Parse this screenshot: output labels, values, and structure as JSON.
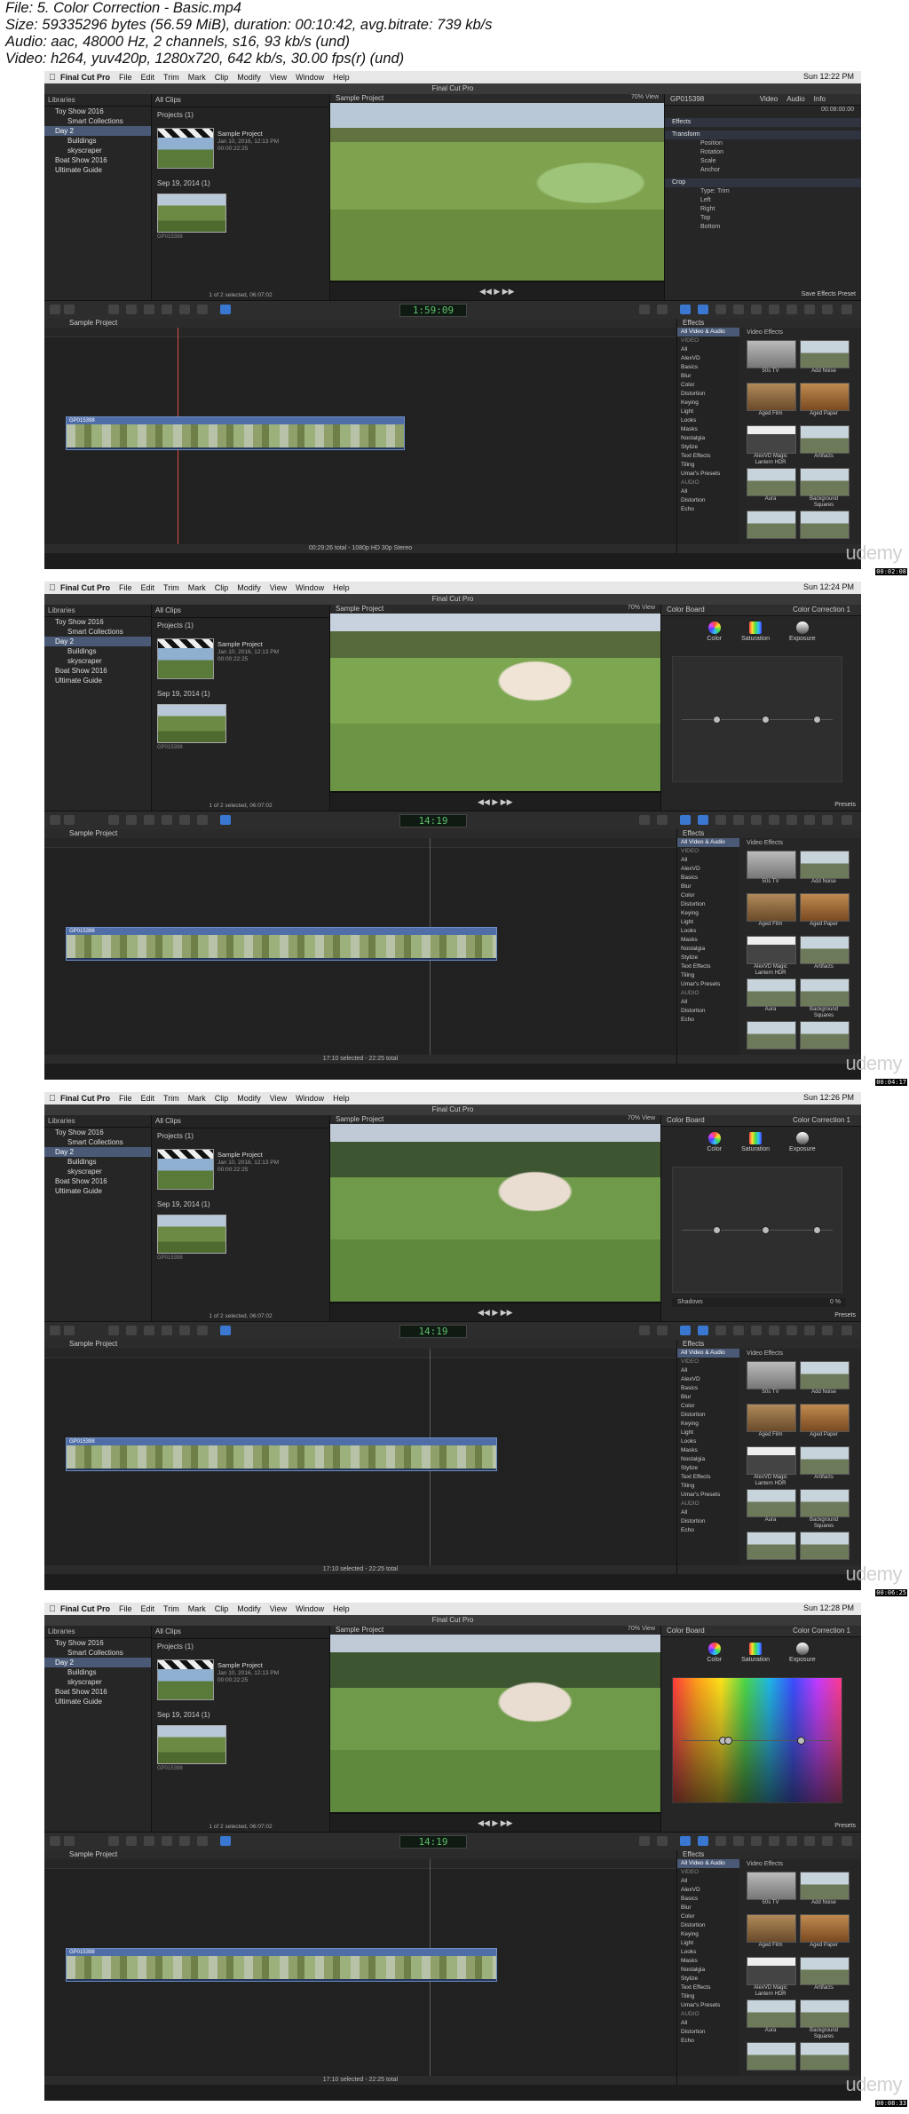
{
  "header": {
    "line1": "File: 5. Color Correction - Basic.mp4",
    "line2": "Size: 59335296 bytes (56.59 MiB), duration: 00:10:42, avg.bitrate: 739 kb/s",
    "line3": "Audio: aac, 48000 Hz, 2 channels, s16, 93 kb/s (und)",
    "line4": "Video: h264, yuv420p, 1280x720, 642 kb/s, 30.00 fps(r) (und)"
  },
  "menu": [
    "Final Cut Pro",
    "File",
    "Edit",
    "Trim",
    "Mark",
    "Clip",
    "Modify",
    "View",
    "Window",
    "Help"
  ],
  "app_title": "Final Cut Pro",
  "library": {
    "header": "Libraries",
    "items": [
      "Toy Show 2016",
      "Smart Collections",
      "Day 2",
      "Buildings",
      "skyscraper",
      "Boat Show 2016",
      "Ultimate Guide"
    ]
  },
  "browser": {
    "filter": "All Clips",
    "projects_label": "Projects",
    "projects_count": "(1)",
    "project_name": "Sample Project",
    "project_date": "Jan 10, 2016, 12:13 PM",
    "project_dur": "00:00:22:25",
    "date_group": "Sep 19, 2014",
    "date_count": "(1)",
    "clip_id": "GP015398",
    "status": "1 of 2 selected, 06:07:02"
  },
  "viewer": {
    "title": "Sample Project",
    "zoom": "70%",
    "view": "View"
  },
  "effects": {
    "title": "Effects",
    "all_label": "All Video & Audio",
    "video_header": "Video Effects",
    "categories": [
      "VIDEO",
      "All",
      "AlexVD",
      "Basics",
      "Blur",
      "Color",
      "Distortion",
      "Keying",
      "Light",
      "Looks",
      "Masks",
      "Nostalgia",
      "Stylize",
      "Text Effects",
      "Tiling",
      "Umar's Presets",
      "AUDIO",
      "All",
      "Distortion",
      "Echo"
    ],
    "tiles": [
      "50s TV",
      "Add Noise",
      "Aged Film",
      "Aged Paper",
      "AlexVD Magic Lantern HDR",
      "Artifacts",
      "Aura",
      "Background Squares"
    ]
  },
  "frames": [
    {
      "time": "Sun 12:22 PM",
      "timecode": "1:59:09",
      "inspector_mode": "effects",
      "clip_name": "GP015398",
      "clip_tc": "00:08:00:00",
      "insp_tabs": [
        "Video",
        "Audio",
        "Info"
      ],
      "insp_rows": [
        "Effects",
        "Transform",
        "Position",
        "Rotation",
        "Scale",
        "Anchor",
        "Crop",
        "Type: Trim",
        "Left",
        "Right",
        "Top",
        "Bottom"
      ],
      "save_preset": "Save Effects Preset",
      "timeline_label": "Sample Project",
      "timeline_status": "00:29:26 total - 1080p HD 30p Stereo",
      "stamp": "00:02:08"
    },
    {
      "time": "Sun 12:24 PM",
      "timecode": "14:19",
      "inspector_mode": "exposure",
      "board_label": "Color Board",
      "correction_label": "Color Correction 1",
      "tabs": [
        "Color",
        "Saturation",
        "Exposure"
      ],
      "presets": "Presets",
      "timeline_label": "Sample Project",
      "clip_name": "GP015398",
      "timeline_status": "17:10 selected - 22:25 total",
      "stamp": "00:04:17"
    },
    {
      "time": "Sun 12:26 PM",
      "timecode": "14:19",
      "inspector_mode": "exposure-shadows",
      "board_label": "Color Board",
      "correction_label": "Color Correction 1",
      "tabs": [
        "Color",
        "Saturation",
        "Exposure"
      ],
      "shadows_label": "Shadows",
      "shadows_value": "0 %",
      "presets": "Presets",
      "timeline_label": "Sample Project",
      "clip_name": "GP015398",
      "timeline_status": "17:10 selected - 22:25 total",
      "stamp": "00:06:25"
    },
    {
      "time": "Sun 12:28 PM",
      "timecode": "14:19",
      "inspector_mode": "color",
      "board_label": "Color Board",
      "correction_label": "Color Correction 1",
      "tabs": [
        "Color",
        "Saturation",
        "Exposure"
      ],
      "presets": "Presets",
      "timeline_label": "Sample Project",
      "clip_name": "GP015398",
      "timeline_status": "17:10 selected - 22:25 total",
      "stamp": "00:08:33"
    }
  ],
  "watermark": "udemy",
  "colors": {
    "accent": "#3a77d1",
    "playhead": "#e24b4b",
    "timecode": "#5fbf6a"
  }
}
